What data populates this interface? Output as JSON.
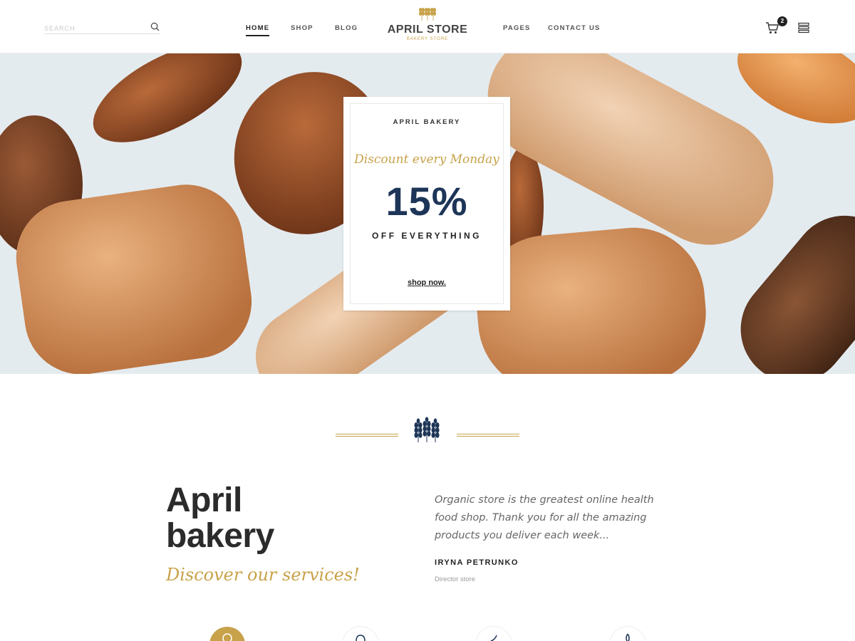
{
  "header": {
    "search_placeholder": "SEARCH",
    "nav_left": [
      "HOME",
      "SHOP",
      "BLOG"
    ],
    "nav_right": [
      "PAGES",
      "CONTACT US"
    ],
    "logo_name": "APRIL STORE",
    "logo_sub": "BAKERY STORE",
    "cart_count": "2"
  },
  "hero": {
    "kicker": "APRIL BAKERY",
    "script": "Discount every Monday",
    "big": "15%",
    "off": "OFF EVERYTHING",
    "cta": "shop now."
  },
  "about": {
    "title_line1": "April",
    "title_line2": "bakery",
    "script": "Discover our services!",
    "quote": "Organic  store is the greatest online health food shop. Thank you for all the amazing products you deliver each week...",
    "author": "IRYNA PETRUNKO",
    "role": "Director store"
  },
  "colors": {
    "accent_gold": "#c8a24a",
    "navy": "#1d3557",
    "text_dark": "#2b2b2b"
  },
  "icons": {
    "search": "search-icon",
    "cart": "cart-icon",
    "menu": "menu-icon",
    "wheat": "wheat-icon"
  }
}
